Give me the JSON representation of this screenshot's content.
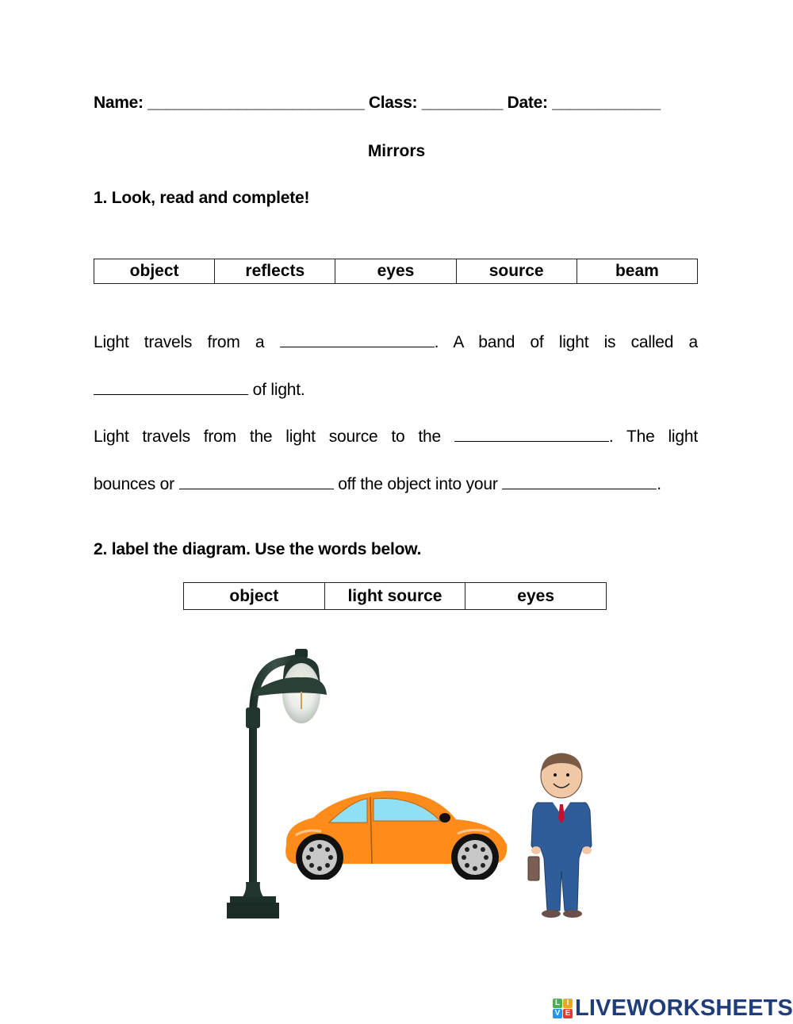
{
  "header": {
    "name_label": "Name:",
    "name_blank": "________________________",
    "class_label": "Class:",
    "class_blank": "_________",
    "date_label": "Date:",
    "date_blank": "____________"
  },
  "title": "Mirrors",
  "section1": {
    "heading": "1. Look, read and complete!",
    "word_bank": [
      "object",
      "reflects",
      "eyes",
      "source",
      "beam"
    ],
    "sentences": {
      "s1_part1": "Light travels from a",
      "s1_part2": ". A band of light is called a",
      "s1_part3": "of light.",
      "s2_part1": "Light travels from the light source to the",
      "s2_part2": ". The light",
      "s2_part3": "bounces or",
      "s2_part4": "off the object into your",
      "s2_part5": "."
    }
  },
  "section2": {
    "heading": "2. label the diagram. Use the words below.",
    "word_bank": [
      "object",
      "light source",
      "eyes"
    ],
    "diagram_items": [
      "street-lamp",
      "car",
      "man"
    ]
  },
  "brand": {
    "logo_letters": [
      "L",
      "I",
      "V",
      "E"
    ],
    "logo_colors": [
      "#4caf50",
      "#f5a623",
      "#2196f3",
      "#e53935"
    ],
    "name": "LIVEWORKSHEETS",
    "color": "#1f3d7a"
  }
}
